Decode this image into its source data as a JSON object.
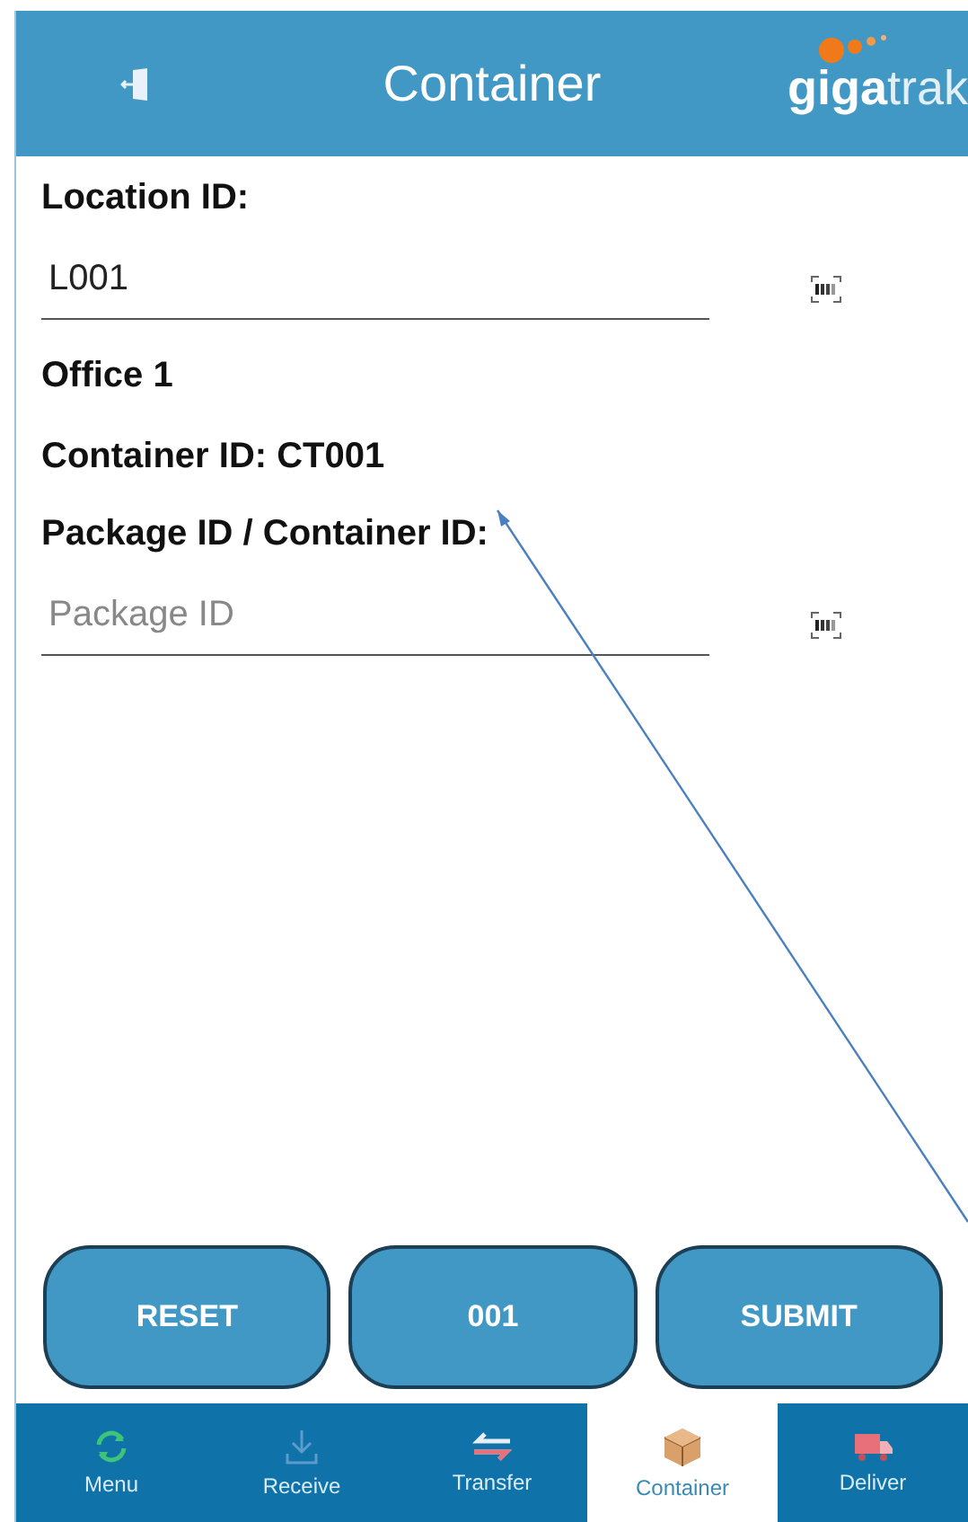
{
  "header": {
    "title": "Container",
    "logo": {
      "bold": "giga",
      "light": "trak"
    }
  },
  "location": {
    "label": "Location ID:",
    "value": "L001"
  },
  "location_name": "Office 1",
  "container_line": "Container ID: CT001",
  "package": {
    "label": "Package ID / Container ID:",
    "placeholder": "Package ID"
  },
  "buttons": [
    "RESET",
    "001",
    "SUBMIT"
  ],
  "nav": [
    {
      "kind": "menu",
      "label": "Menu",
      "selected": false
    },
    {
      "kind": "receive",
      "label": "Receive",
      "selected": false
    },
    {
      "kind": "transfer",
      "label": "Transfer",
      "selected": false
    },
    {
      "kind": "container",
      "label": "Container",
      "selected": true
    },
    {
      "kind": "deliver",
      "label": "Deliver",
      "selected": false
    }
  ]
}
